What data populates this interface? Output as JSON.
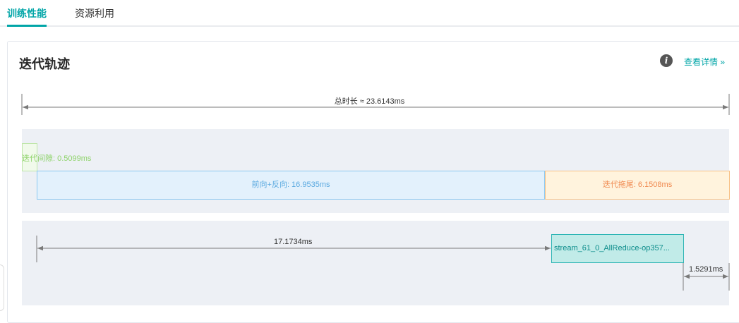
{
  "tabs": [
    {
      "label": "训练性能",
      "active": true
    },
    {
      "label": "资源利用",
      "active": false
    }
  ],
  "panel": {
    "title": "迭代轨迹",
    "info_icon": "info-icon",
    "detail_link": "查看详情 »"
  },
  "trace": {
    "total_label": "总时长 ≈ 23.6143ms",
    "segments": {
      "iteration_gap": "迭代间隙: 0.5099ms",
      "forward_backward": "前向+反向: 16.9535ms",
      "iteration_tail": "迭代拖尾: 6.1508ms"
    },
    "stream": {
      "label": "stream_61_0_AllReduce-op357...",
      "before_duration": "17.1734ms",
      "after_duration": "1.5291ms"
    }
  },
  "colors": {
    "accent": "#00a5a7",
    "gap": "#8fd36b",
    "forward_backward": "#5aa9e0",
    "tail": "#f0894f",
    "stream": "#2cb4b4"
  }
}
